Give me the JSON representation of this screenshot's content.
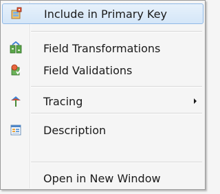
{
  "menu": {
    "items": [
      {
        "label": "Include in Primary Key",
        "icon": "primary-key-icon",
        "highlighted": true
      },
      {
        "label": "Field Transformations",
        "icon": "field-transformations-icon"
      },
      {
        "label": "Field Validations",
        "icon": "field-validations-icon"
      },
      {
        "label": "Tracing",
        "icon": "tracing-icon",
        "submenu": true
      },
      {
        "label": "Description",
        "icon": "description-icon"
      },
      {
        "label": "Open in New Window"
      }
    ]
  },
  "colors": {
    "highlight_fill": "#d4e6f8",
    "highlight_border": "#8fb8e6",
    "menu_background": "#f5f5f5"
  }
}
